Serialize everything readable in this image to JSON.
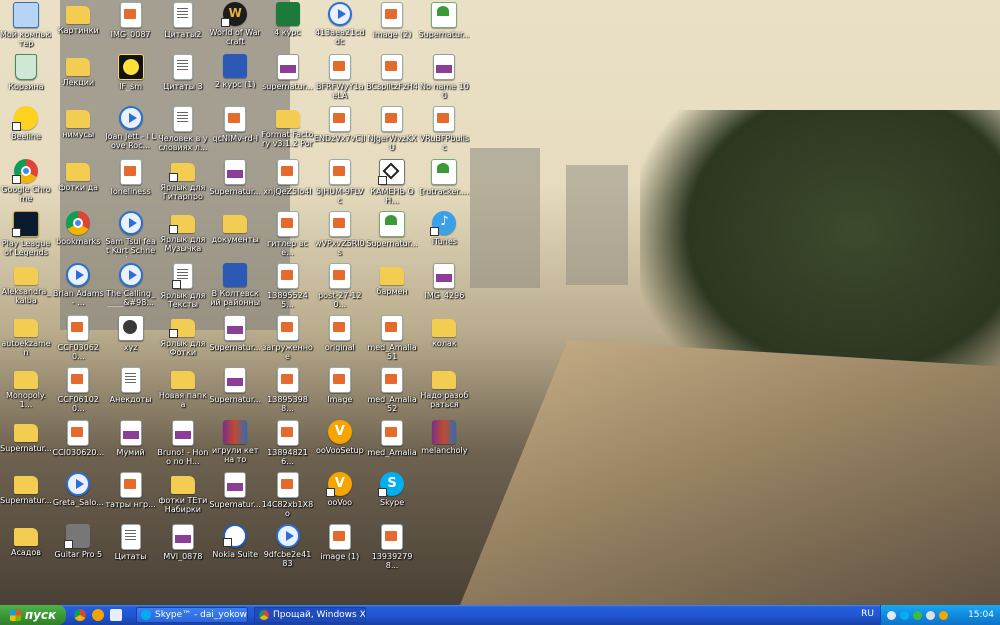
{
  "desktop": {
    "icons": [
      {
        "label": "Мой компьютер",
        "type": "computer",
        "sc": false
      },
      {
        "label": "Корзина",
        "type": "trash",
        "sc": false
      },
      {
        "label": "Beeline",
        "type": "beeline",
        "sc": true
      },
      {
        "label": "Google Chrome",
        "type": "chrome",
        "sc": true
      },
      {
        "label": "Play League of Legends",
        "type": "league",
        "sc": true
      },
      {
        "label": "Aleksandra_kalba",
        "type": "folder",
        "sc": false
      },
      {
        "label": "autoekzamen",
        "type": "folder",
        "sc": false
      },
      {
        "label": "Monopoly.1...",
        "type": "folder",
        "sc": false
      },
      {
        "label": "Supernatur...",
        "type": "folder",
        "sc": false
      },
      {
        "label": "Supernatur...",
        "type": "folder",
        "sc": false
      },
      {
        "label": "Асадов",
        "type": "folder",
        "sc": false
      },
      {
        "label": "Картинки",
        "type": "folder",
        "sc": false
      },
      {
        "label": "Лекции",
        "type": "folder",
        "sc": false
      },
      {
        "label": "нимусы",
        "type": "folder",
        "sc": false
      },
      {
        "label": "фотки да",
        "type": "folder",
        "sc": false
      },
      {
        "label": "bookmarks",
        "type": "chrome",
        "sc": false
      },
      {
        "label": "Brian Adams - ...",
        "type": "media",
        "sc": false
      },
      {
        "label": "CCF030620...",
        "type": "img",
        "sc": false
      },
      {
        "label": "CCF061020...",
        "type": "img",
        "sc": false
      },
      {
        "label": "CCI030620...",
        "type": "img",
        "sc": false
      },
      {
        "label": "Greta_Salo...",
        "type": "media",
        "sc": false
      },
      {
        "label": "Guitar Pro 5",
        "type": "guitarpro",
        "sc": true
      },
      {
        "label": "IMG_0087",
        "type": "img",
        "sc": false
      },
      {
        "label": "IF_sm",
        "type": "djvu",
        "sc": false
      },
      {
        "label": "Joan Jett - I Love Roc...",
        "type": "media",
        "sc": false
      },
      {
        "label": "loneliness",
        "type": "img",
        "sc": false
      },
      {
        "label": "Sam Tsui feat Kurt Schnei...",
        "type": "media",
        "sc": false
      },
      {
        "label": "The Calling_ ____&#98...",
        "type": "media",
        "sc": false
      },
      {
        "label": "xyz",
        "type": "sscat",
        "sc": false
      },
      {
        "label": "Анекдоты",
        "type": "doc",
        "sc": false
      },
      {
        "label": "Мумий",
        "type": "mp4",
        "sc": false
      },
      {
        "label": "татры нгр...",
        "type": "img",
        "sc": false
      },
      {
        "label": "Цитаты",
        "type": "doc",
        "sc": false
      },
      {
        "label": "Цитаты2",
        "type": "doc",
        "sc": false
      },
      {
        "label": "Цитаты 3",
        "type": "doc",
        "sc": false
      },
      {
        "label": "Человек в условиях л...",
        "type": "doc",
        "sc": false
      },
      {
        "label": "Ярлык для Гитарпро",
        "type": "folder",
        "sc": true
      },
      {
        "label": "Ярлык для Музычка",
        "type": "folder",
        "sc": true
      },
      {
        "label": "Ярлык для Тексты",
        "type": "doc",
        "sc": true
      },
      {
        "label": "Ярлык для Фотки",
        "type": "folder",
        "sc": true
      },
      {
        "label": "Новая папка",
        "type": "folder",
        "sc": false
      },
      {
        "label": "Bruno! - Hono no H...",
        "type": "mp4",
        "sc": false
      },
      {
        "label": "фотки ТЕти Набирки",
        "type": "folder",
        "sc": false
      },
      {
        "label": "MVI_0878",
        "type": "mp4",
        "sc": false
      },
      {
        "label": "World of Warcraft",
        "type": "wow",
        "sc": true
      },
      {
        "label": "2 курс (1)",
        "type": "word",
        "sc": false
      },
      {
        "label": "qcNIMv-rd-I",
        "type": "img",
        "sc": false
      },
      {
        "label": "Supernatur...",
        "type": "mp4",
        "sc": false
      },
      {
        "label": "документы",
        "type": "folder",
        "sc": false
      },
      {
        "label": "В Колтевский районный с...",
        "type": "word",
        "sc": false
      },
      {
        "label": "Supernatur...",
        "type": "mp4",
        "sc": false
      },
      {
        "label": "Supernatur...",
        "type": "mp4",
        "sc": false
      },
      {
        "label": "игрули кет на то",
        "type": "winrar",
        "sc": false
      },
      {
        "label": "Supernatur...",
        "type": "mp4",
        "sc": false
      },
      {
        "label": "Nokia Suite",
        "type": "nokia",
        "sc": true
      },
      {
        "label": "4 курс",
        "type": "excel",
        "sc": false
      },
      {
        "label": "supernatur...",
        "type": "mp4",
        "sc": false
      },
      {
        "label": "Format Factory v3.1.2 Port...",
        "type": "folder",
        "sc": false
      },
      {
        "label": "xnjQeZ5lo4I",
        "type": "img",
        "sc": false
      },
      {
        "label": "гитлер все...",
        "type": "img",
        "sc": false
      },
      {
        "label": "138955245...",
        "type": "img",
        "sc": false
      },
      {
        "label": "загруженное",
        "type": "img",
        "sc": false
      },
      {
        "label": "138953988...",
        "type": "img",
        "sc": false
      },
      {
        "label": "138948216...",
        "type": "img",
        "sc": false
      },
      {
        "label": "14C82xb1X8o",
        "type": "img",
        "sc": false
      },
      {
        "label": "9dfcbe2e4183",
        "type": "media",
        "sc": false
      },
      {
        "label": "413aea21cddc",
        "type": "media",
        "sc": false
      },
      {
        "label": "BFRFWyY1aeLA",
        "type": "img",
        "sc": false
      },
      {
        "label": "ENDzVx7vCJI",
        "type": "img",
        "sc": false
      },
      {
        "label": "5jHUM-9FLVc",
        "type": "img",
        "sc": false
      },
      {
        "label": "wVPxvZ5Rl0s",
        "type": "img",
        "sc": false
      },
      {
        "label": "post-27-120...",
        "type": "img",
        "sc": false
      },
      {
        "label": "original",
        "type": "img",
        "sc": false
      },
      {
        "label": "Image",
        "type": "img",
        "sc": false
      },
      {
        "label": "ooVooSetup",
        "type": "oovoo",
        "sc": false
      },
      {
        "label": "ooVoo",
        "type": "oovoo",
        "sc": true
      },
      {
        "label": "image (1)",
        "type": "img",
        "sc": false
      },
      {
        "label": "image (2)",
        "type": "img",
        "sc": false
      },
      {
        "label": "BCsplitzFzH4",
        "type": "img",
        "sc": false
      },
      {
        "label": "NJgerWvzKXU",
        "type": "img",
        "sc": false
      },
      {
        "label": "КАМЕНЬ ОН...",
        "type": "unity",
        "sc": true
      },
      {
        "label": "Supernatur...",
        "type": "torrent",
        "sc": false
      },
      {
        "label": "бармен",
        "type": "folder",
        "sc": false
      },
      {
        "label": "med_Amalia51",
        "type": "img",
        "sc": false
      },
      {
        "label": "med_Amalia52",
        "type": "img",
        "sc": false
      },
      {
        "label": "med_Amalia",
        "type": "img",
        "sc": false
      },
      {
        "label": "Skype",
        "type": "skype",
        "sc": true
      },
      {
        "label": "139392798...",
        "type": "img",
        "sc": false
      },
      {
        "label": "Supernatur...",
        "type": "torrent",
        "sc": false
      },
      {
        "label": "No name 100",
        "type": "mp4",
        "sc": false
      },
      {
        "label": "VRuBFPbullsc",
        "type": "img",
        "sc": false
      },
      {
        "label": "[rutracker....",
        "type": "torrent",
        "sc": false
      },
      {
        "label": "iTunes",
        "type": "itunes",
        "sc": true
      },
      {
        "label": "IMG_4296",
        "type": "mp4",
        "sc": false
      },
      {
        "label": "колак",
        "type": "folder",
        "sc": false
      },
      {
        "label": "Надо разобраться",
        "type": "folder",
        "sc": false
      },
      {
        "label": "melancholy",
        "type": "winrar",
        "sc": false
      }
    ]
  },
  "taskbar": {
    "start_label": "пуск",
    "quicklaunch": [
      "chrome-icon",
      "media-player-icon",
      "explorer-icon"
    ],
    "tasks": [
      {
        "label": "Skype™ - dai_yokowo",
        "icon": "skype-icon",
        "active": false
      },
      {
        "label": "Прощай, Windows X...",
        "icon": "chrome-icon",
        "active": true
      }
    ],
    "language": "RU",
    "clock": "15:04"
  },
  "colors": {
    "taskbar_blue": "#245edb",
    "start_green": "#3c9a36",
    "tray_blue": "#118ae0"
  }
}
